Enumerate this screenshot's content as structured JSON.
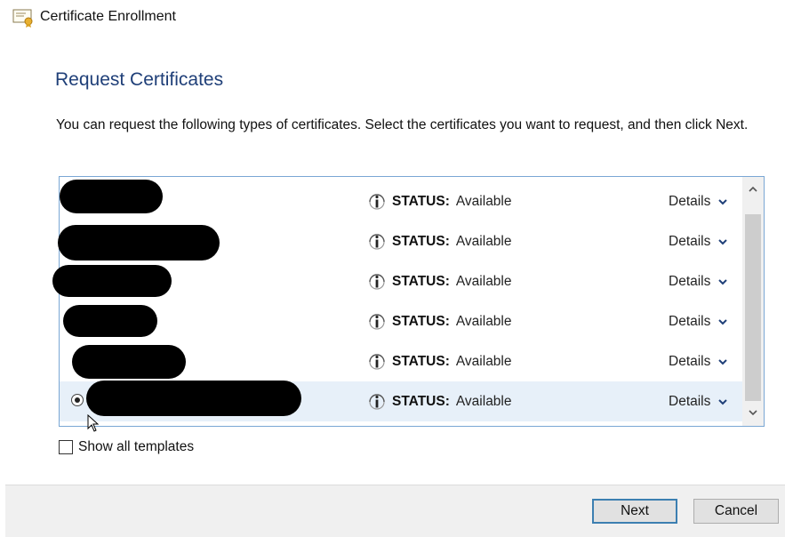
{
  "window": {
    "title": "Certificate Enrollment",
    "icon": "certificate-icon"
  },
  "heading": "Request Certificates",
  "instructions": "You can request the following types of certificates. Select the certificates you want to request, and then click Next.",
  "certificates": [
    {
      "name": "",
      "status_label": "STATUS:",
      "status_value": "Available",
      "details_label": "Details",
      "selected": false
    },
    {
      "name": "",
      "status_label": "STATUS:",
      "status_value": "Available",
      "details_label": "Details",
      "selected": false
    },
    {
      "name": "",
      "status_label": "STATUS:",
      "status_value": "Available",
      "details_label": "Details",
      "selected": false
    },
    {
      "name": "",
      "status_label": "STATUS:",
      "status_value": "Available",
      "details_label": "Details",
      "selected": false
    },
    {
      "name": "",
      "status_label": "STATUS:",
      "status_value": "Available",
      "details_label": "Details",
      "selected": false
    },
    {
      "name": "",
      "status_label": "STATUS:",
      "status_value": "Available",
      "details_label": "Details",
      "selected": true
    }
  ],
  "show_all_templates": {
    "label": "Show all templates",
    "checked": false
  },
  "buttons": {
    "next": "Next",
    "cancel": "Cancel"
  },
  "colors": {
    "heading": "#1f3f78",
    "list_border": "#7aa7d4",
    "selected_row": "#e7f0f9",
    "next_border": "#3c7fb1"
  }
}
